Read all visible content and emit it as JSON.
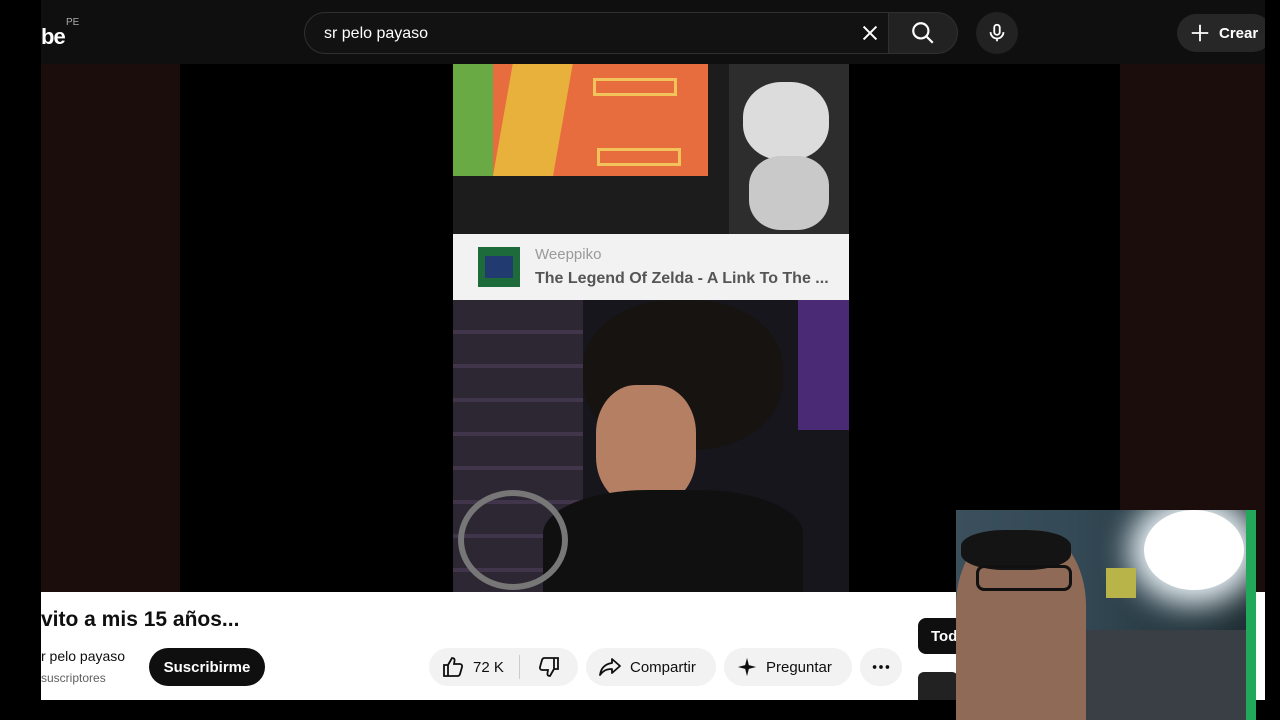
{
  "header": {
    "logo_text": "be",
    "country_code": "PE",
    "search_value": "sr pelo payaso",
    "create_label": "Crear"
  },
  "video_overlay": {
    "card_channel": "Weeppiko",
    "card_title": "The Legend Of Zelda - A Link To The ..."
  },
  "video": {
    "title": "vito a mis 15 años...",
    "channel_name": "r pelo payaso",
    "subscribers": "suscriptores",
    "subscribe_label": "Suscribirme",
    "likes": "72 K",
    "share_label": "Compartir",
    "ask_label": "Preguntar"
  },
  "sidebar": {
    "chip_label": "Tod"
  },
  "icons": [
    "close-icon",
    "search-icon",
    "mic-icon",
    "plus-icon",
    "like-icon",
    "dislike-icon",
    "share-icon",
    "sparkle-icon",
    "more-icon"
  ],
  "colors": {
    "background": "#0f0f0f",
    "subscribe_bg": "#0f0f0f",
    "pill_bg": "#f2f2f2"
  }
}
